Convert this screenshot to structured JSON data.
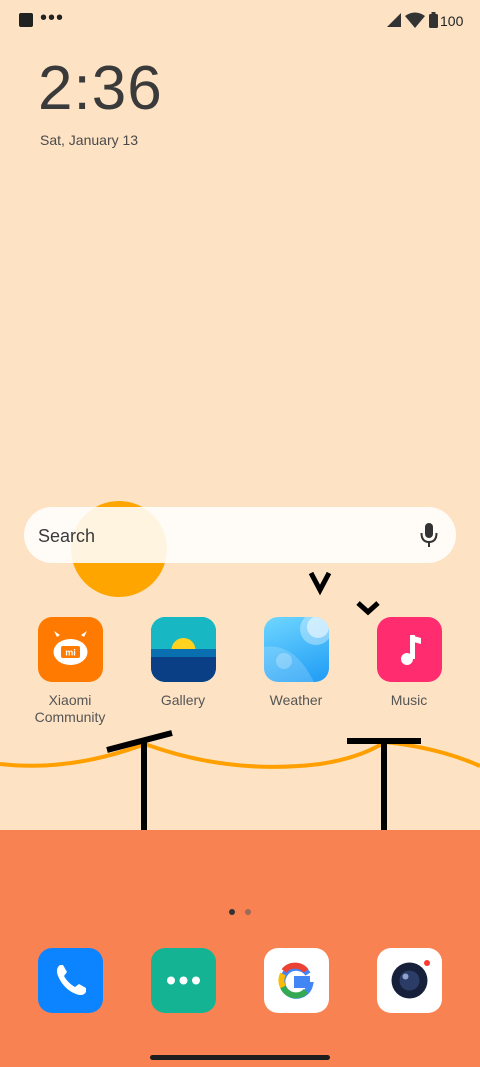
{
  "status_bar": {
    "notification_icons": [
      "app-notification-icon",
      "more-notifications-icon"
    ],
    "more_glyph": "•••",
    "battery_level": "100"
  },
  "clock": {
    "time": "2:36",
    "date": "Sat, January 13"
  },
  "search": {
    "placeholder": "Search",
    "icon": "microphone-icon"
  },
  "apps": [
    {
      "label": "Xiaomi\nCommunity",
      "icon": "xiaomi-community-icon"
    },
    {
      "label": "Gallery",
      "icon": "gallery-icon"
    },
    {
      "label": "Weather",
      "icon": "weather-icon"
    },
    {
      "label": "Music",
      "icon": "music-icon"
    }
  ],
  "page_indicator": {
    "pages": 2,
    "current": 1
  },
  "dock": [
    {
      "icon": "phone-icon",
      "color": "#0D84FF"
    },
    {
      "icon": "messages-icon",
      "color": "#13B394"
    },
    {
      "icon": "google-icon",
      "color": "#FFFFFF"
    },
    {
      "icon": "camera-icon",
      "color": "#FFFFFF"
    }
  ],
  "colors": {
    "wallpaper_sky": "#FDE3C4",
    "wallpaper_ground": "#F98253",
    "sun": "#FFA500",
    "xiaomi": "#FF7A00",
    "music": "#FF2D6F"
  }
}
